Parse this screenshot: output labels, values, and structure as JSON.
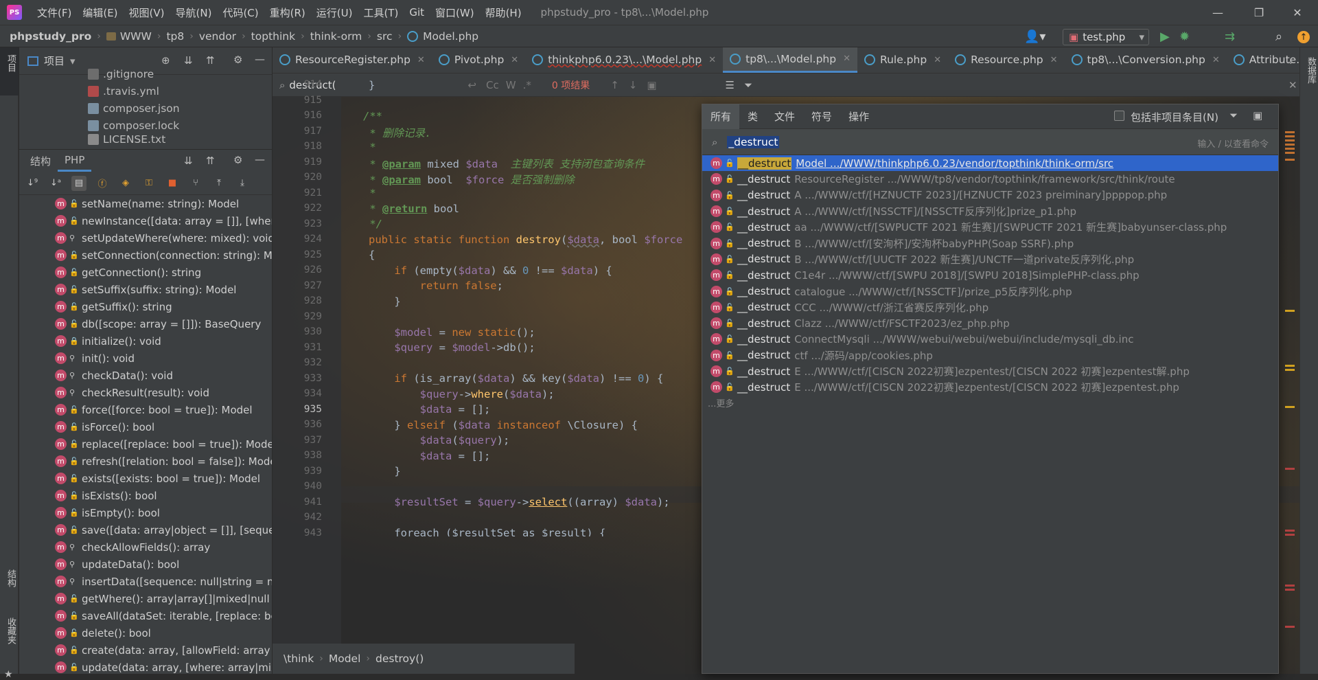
{
  "app": {
    "window_title": "phpstudy_pro - tp8\\...\\Model.php",
    "menus": [
      "文件(F)",
      "编辑(E)",
      "视图(V)",
      "导航(N)",
      "代码(C)",
      "重构(R)",
      "运行(U)",
      "工具(T)",
      "Git",
      "窗口(W)",
      "帮助(H)"
    ],
    "logo_text": "PS",
    "win_min": "—",
    "win_max": "❐",
    "win_close": "✕"
  },
  "breadcrumb": [
    "phpstudy_pro",
    "WWW",
    "tp8",
    "vendor",
    "topthink",
    "think-orm",
    "src",
    "Model.php"
  ],
  "run_config": "test.php",
  "left_strip": {
    "top_label": "项目",
    "bottom_label1": "结构",
    "bottom_label2": "收藏夹"
  },
  "right_strip": {
    "label": "数据库"
  },
  "project_panel": {
    "title": "项目",
    "files": [
      ".gitignore",
      ".travis.yml",
      "composer.json",
      "composer.lock",
      "LICENSE.txt"
    ]
  },
  "structure_panel": {
    "tabs": [
      "结构",
      "PHP"
    ],
    "members": [
      {
        "text": "setName(name: string): Model",
        "vis": "public"
      },
      {
        "text": "newInstance([data: array = []], [where: mix",
        "vis": "public"
      },
      {
        "text": "setUpdateWhere(where: mixed): void",
        "vis": "protected"
      },
      {
        "text": "setConnection(connection: string): Model",
        "vis": "public"
      },
      {
        "text": "getConnection(): string",
        "vis": "public"
      },
      {
        "text": "setSuffix(suffix: string): Model",
        "vis": "public"
      },
      {
        "text": "getSuffix(): string",
        "vis": "public"
      },
      {
        "text": "db([scope: array = []]): BaseQuery",
        "vis": "public"
      },
      {
        "text": "initialize(): void",
        "vis": "private"
      },
      {
        "text": "init(): void",
        "vis": "protected"
      },
      {
        "text": "checkData(): void",
        "vis": "protected"
      },
      {
        "text": "checkResult(result): void",
        "vis": "protected"
      },
      {
        "text": "force([force: bool = true]): Model",
        "vis": "public"
      },
      {
        "text": "isForce(): bool",
        "vis": "public"
      },
      {
        "text": "replace([replace: bool = true]): Model",
        "vis": "public"
      },
      {
        "text": "refresh([relation: bool = false]): Model",
        "vis": "public"
      },
      {
        "text": "exists([exists: bool = true]): Model",
        "vis": "public"
      },
      {
        "text": "isExists(): bool",
        "vis": "public"
      },
      {
        "text": "isEmpty(): bool",
        "vis": "public"
      },
      {
        "text": "save([data: array|object = []], [sequence:",
        "vis": "public"
      },
      {
        "text": "checkAllowFields(): array",
        "vis": "protected"
      },
      {
        "text": "updateData(): bool",
        "vis": "protected"
      },
      {
        "text": "insertData([sequence: null|string = null]):",
        "vis": "protected"
      },
      {
        "text": "getWhere(): array|array[]|mixed|null",
        "vis": "public"
      },
      {
        "text": "saveAll(dataSet: iterable, [replace: bool =",
        "vis": "public"
      },
      {
        "text": "delete(): bool",
        "vis": "public"
      },
      {
        "text": "create(data: array, [allowField: array = []],",
        "vis": "public"
      },
      {
        "text": "update(data: array, [where: array|mixed =",
        "vis": "public"
      }
    ]
  },
  "editor_tabs": [
    {
      "label": "ResourceRegister.php",
      "active": false
    },
    {
      "label": "Pivot.php",
      "active": false
    },
    {
      "label": "thinkphp6.0.23\\...\\Model.php",
      "active": false
    },
    {
      "label": "tp8\\...\\Model.php",
      "active": true
    },
    {
      "label": "Rule.php",
      "active": false
    },
    {
      "label": "Resource.php",
      "active": false
    },
    {
      "label": "tp8\\...\\Conversion.php",
      "active": false
    },
    {
      "label": "Attribute.p",
      "active": false
    }
  ],
  "find_bar": {
    "query": "destruct(",
    "results": "0 项结果",
    "opt_cc": "Cc",
    "opt_w": "W",
    "opt_regex": ".*"
  },
  "line_numbers": [
    "914",
    "915",
    "916",
    "917",
    "918",
    "919",
    "920",
    "921",
    "922",
    "923",
    "924",
    "925",
    "926",
    "927",
    "928",
    "929",
    "930",
    "931",
    "932",
    "933",
    "934",
    "935",
    "936",
    "937",
    "938",
    "939",
    "940",
    "941",
    "942",
    "943"
  ],
  "current_line": "935",
  "code": {
    "l914": "}",
    "l916": "/**",
    "l917": " * 删除记录.",
    "l918": " *",
    "l919_a": " * ",
    "l919_tag": "@param",
    "l919_b": " mixed ",
    "l919_var": "$data",
    "l919_c": "  主键列表 支持闭包查询条件",
    "l920_a": " * ",
    "l920_tag": "@param",
    "l920_b": " bool  ",
    "l920_var": "$force",
    "l920_c": " 是否强制删除",
    "l921": " *",
    "l922_a": " * ",
    "l922_tag": "@return",
    "l922_b": " bool",
    "l923": " */",
    "l924_kw": "public static function ",
    "l924_fn": "destroy",
    "l924_p1": "(",
    "l924_v1": "$data",
    "l924_p2": ", bool ",
    "l924_v2": "$force",
    "l925": "{",
    "l926_kw": "    if ",
    "l926_p1": "(empty(",
    "l926_v1": "$data",
    "l926_p2": ") && ",
    "l926_num": "0",
    "l926_p3": " !== ",
    "l926_v2": "$data",
    "l926_p4": ") {",
    "l927_kw": "        return false",
    "l927_p": ";",
    "l928": "    }",
    "l930_v": "    $model",
    "l930_p": " = ",
    "l930_kw": "new static",
    "l930_e": "();",
    "l931_v": "    $query",
    "l931_p": " = ",
    "l931_v2": "$model",
    "l931_e": "->db();",
    "l933_kw": "    if ",
    "l933_p1": "(is_array(",
    "l933_v1": "$data",
    "l933_p2": ") && key(",
    "l933_v2": "$data",
    "l933_p3": ") !== ",
    "l933_num": "0",
    "l933_p4": ") {",
    "l934_v": "        $query",
    "l934_p": "->",
    "l934_fn": "where",
    "l934_p2": "(",
    "l934_v2": "$data",
    "l934_e": ");",
    "l935_v": "        $data",
    "l935_e": " = [];",
    "l936_p": "    } ",
    "l936_kw": "elseif ",
    "l936_p2": "(",
    "l936_v": "$data",
    "l936_kw2": " instanceof ",
    "l936_e": "\\Closure) {",
    "l937_v": "        $data",
    "l937_p": "(",
    "l937_v2": "$query",
    "l937_e": ");",
    "l938_v": "        $data",
    "l938_e": " = [];",
    "l939": "    }",
    "l941_v": "    $resultSet",
    "l941_p": " = ",
    "l941_v2": "$query",
    "l941_p2": "->",
    "l941_fn": "select",
    "l941_p3": "((array) ",
    "l941_v3": "$data",
    "l941_e": ");",
    "l943": "    foreach ($resultSet as $result) {"
  },
  "editor_breadcrumb": [
    "\\think",
    "Model",
    "destroy()"
  ],
  "search_popup": {
    "tabs": [
      "所有",
      "类",
      "文件",
      "符号",
      "操作"
    ],
    "include_non_project": "包括非项目条目(N)",
    "query": "_destruct",
    "hint": "输入 / 以查看命令",
    "results": [
      {
        "name": "__destruct",
        "path": "Model .../WWW/thinkphp6.0.23/vendor/topthink/think-orm/src"
      },
      {
        "name": "__destruct",
        "path": "ResourceRegister .../WWW/tp8/vendor/topthink/framework/src/think/route"
      },
      {
        "name": "__destruct",
        "path": "A .../WWW/ctf/[HZNUCTF 2023]/[HZNUCTF 2023 preiminary]ppppop.php"
      },
      {
        "name": "__destruct",
        "path": "A .../WWW/ctf/[NSSCTF]/[NSSCTF反序列化]prize_p1.php"
      },
      {
        "name": "__destruct",
        "path": "aa .../WWW/ctf/[SWPUCTF 2021 新生赛]/[SWPUCTF 2021 新生赛]babyunser-class.php"
      },
      {
        "name": "__destruct",
        "path": "B .../WWW/ctf/[安洵杯]/安洵杯babyPHP(Soap SSRF).php"
      },
      {
        "name": "__destruct",
        "path": "B .../WWW/ctf/[UUCTF 2022 新生赛]/UNCTF一道private反序列化.php"
      },
      {
        "name": "__destruct",
        "path": "C1e4r .../WWW/ctf/[SWPU 2018]/[SWPU 2018]SimplePHP-class.php"
      },
      {
        "name": "__destruct",
        "path": "catalogue .../WWW/ctf/[NSSCTF]/prize_p5反序列化.php"
      },
      {
        "name": "__destruct",
        "path": "CCC .../WWW/ctf/浙江省赛反序列化.php"
      },
      {
        "name": "__destruct",
        "path": "Clazz .../WWW/ctf/FSCTF2023/ez_php.php"
      },
      {
        "name": "__destruct",
        "path": "ConnectMysqli .../WWW/webui/webui/webui/include/mysqli_db.inc"
      },
      {
        "name": "__destruct",
        "path": "ctf .../源码/app/cookies.php"
      },
      {
        "name": "__destruct",
        "path": "E .../WWW/ctf/[CISCN 2022初赛]ezpentest/[CISCN 2022 初赛]ezpentest解.php"
      },
      {
        "name": "__destruct",
        "path": "E .../WWW/ctf/[CISCN 2022初赛]ezpentest/[CISCN 2022 初赛]ezpentest.php"
      }
    ],
    "more": "...更多"
  },
  "icons": {
    "method": "m",
    "public": "🔓",
    "protected": "⚲",
    "private": "🔒"
  },
  "colors": {
    "selection": "#2f65ca",
    "match_highlight": "#c8a83a",
    "accent": "#4a88c7",
    "method_icon": "#c24b6a"
  }
}
